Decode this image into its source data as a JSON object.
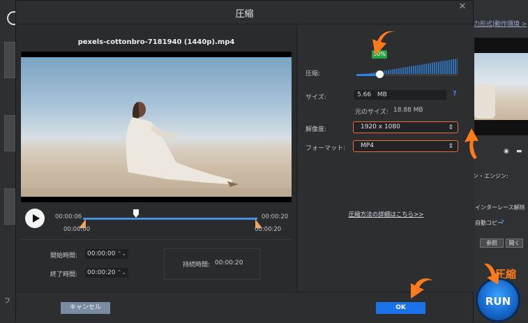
{
  "dialog": {
    "title": "圧縮",
    "file_name": "pexels-cottonbro-7181940 (1440p).mp4",
    "close_icon": "close-icon"
  },
  "player": {
    "play_icon": "play-icon",
    "time_current": "00:00:06",
    "time_total": "00:00:20",
    "trim_start": "00:00:00",
    "trim_end": "00:00:20"
  },
  "time_panel": {
    "start_label": "開始時間:",
    "start_value": "00:00:00",
    "end_label": "終了時間:",
    "end_value": "00:00:20",
    "duration_label": "持続時間:",
    "duration_value": "00:00:20"
  },
  "settings": {
    "compress_label": "圧縮:",
    "compress_percent": "30%",
    "compress_level": 0.23,
    "size_label": "サイズ:",
    "size_value": "5.66",
    "size_unit": "MB",
    "original_size_label": "元のサイズ:",
    "original_size_value": "18.88 MB",
    "resolution_label": "解像度:",
    "resolution_value": "1920 x 1080",
    "format_label": "フォーマット:",
    "format_value": "MP4",
    "details_link": "圧縮方法の詳細はこちら>>"
  },
  "footer": {
    "cancel_label": "キャンセル",
    "ok_label": "OK"
  },
  "background": {
    "top_link": "出力形式|動作環境 >",
    "engine_label": "ョン・エンジン:",
    "deinterlace_label": "インターレース解除",
    "auto_copy_label": "自動コピー",
    "auto_copy_help": "?",
    "browse_label": "参照",
    "open_label": "開く",
    "run_label": "RUN",
    "run_caption": "圧縮",
    "bottom_left_text": "フ"
  },
  "colors": {
    "accent_blue": "#1a73e8",
    "highlight_orange": "#f06a3a",
    "badge_green": "#25a244"
  }
}
